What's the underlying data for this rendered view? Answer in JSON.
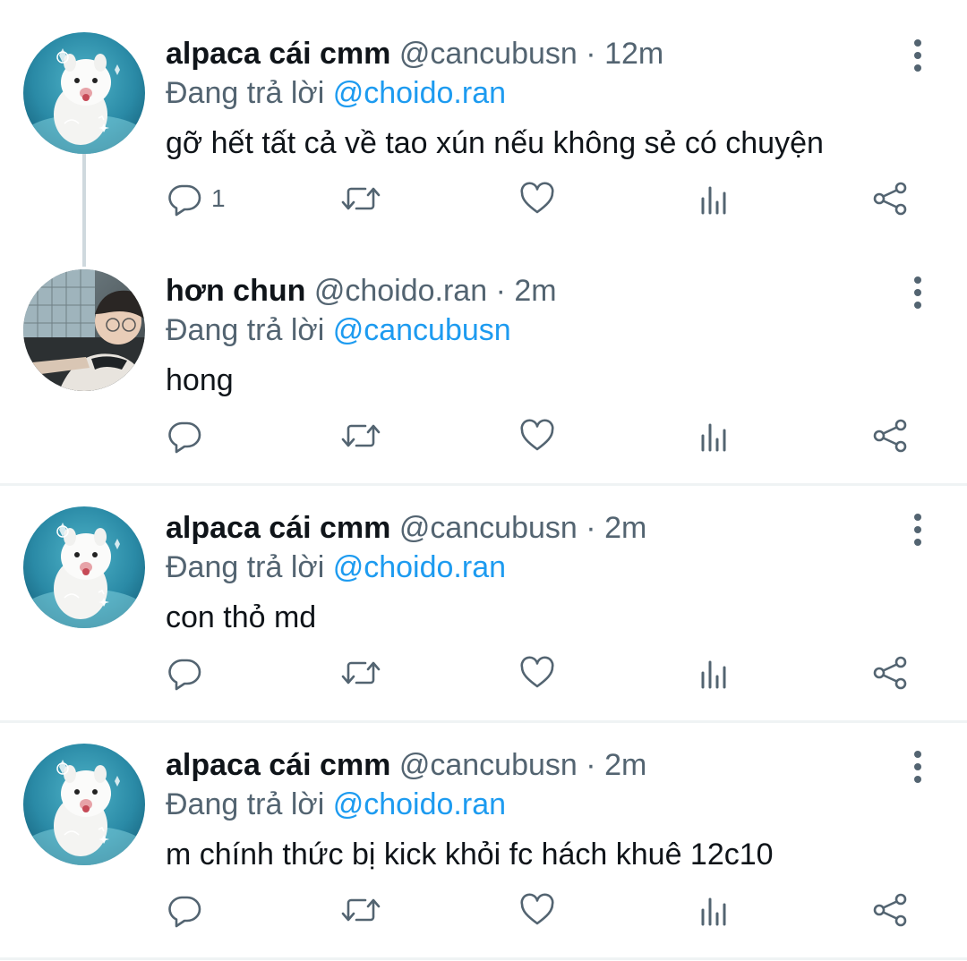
{
  "colors": {
    "name": "#0f1419",
    "secondary": "#536471",
    "link": "#1d9bf0",
    "icon": "#536471",
    "divider": "#eff3f4"
  },
  "tweets": [
    {
      "name": "alpaca cái cmm",
      "handle": "@cancubusn",
      "dot": "·",
      "time": "12m",
      "reply_prefix": "Đang trả lời",
      "reply_to": "@choido.ran",
      "text": "gỡ hết tất cả về tao xún nếu không sẻ có chuyện",
      "reply_count": "1",
      "avatar": "alpaca-avatar"
    },
    {
      "name": "hơn chun",
      "handle": "@choido.ran",
      "dot": "·",
      "time": "2m",
      "reply_prefix": "Đang trả lời",
      "reply_to": "@cancubusn",
      "text": "hong",
      "reply_count": "",
      "avatar": "person-avatar"
    },
    {
      "name": "alpaca cái cmm",
      "handle": "@cancubusn",
      "dot": "·",
      "time": "2m",
      "reply_prefix": "Đang trả lời",
      "reply_to": "@choido.ran",
      "text": "con thỏ md",
      "reply_count": "",
      "avatar": "alpaca-avatar"
    },
    {
      "name": "alpaca cái cmm",
      "handle": "@cancubusn",
      "dot": "·",
      "time": "2m",
      "reply_prefix": "Đang trả lời",
      "reply_to": "@choido.ran",
      "text": "m chính thức bị kick khỏi fc hách khuê 12c10",
      "reply_count": "",
      "avatar": "alpaca-avatar"
    }
  ],
  "icons": {
    "reply": "reply-icon",
    "retweet": "retweet-icon",
    "like": "heart-icon",
    "views": "views-icon",
    "share": "share-icon",
    "more": "more-vertical-icon"
  }
}
